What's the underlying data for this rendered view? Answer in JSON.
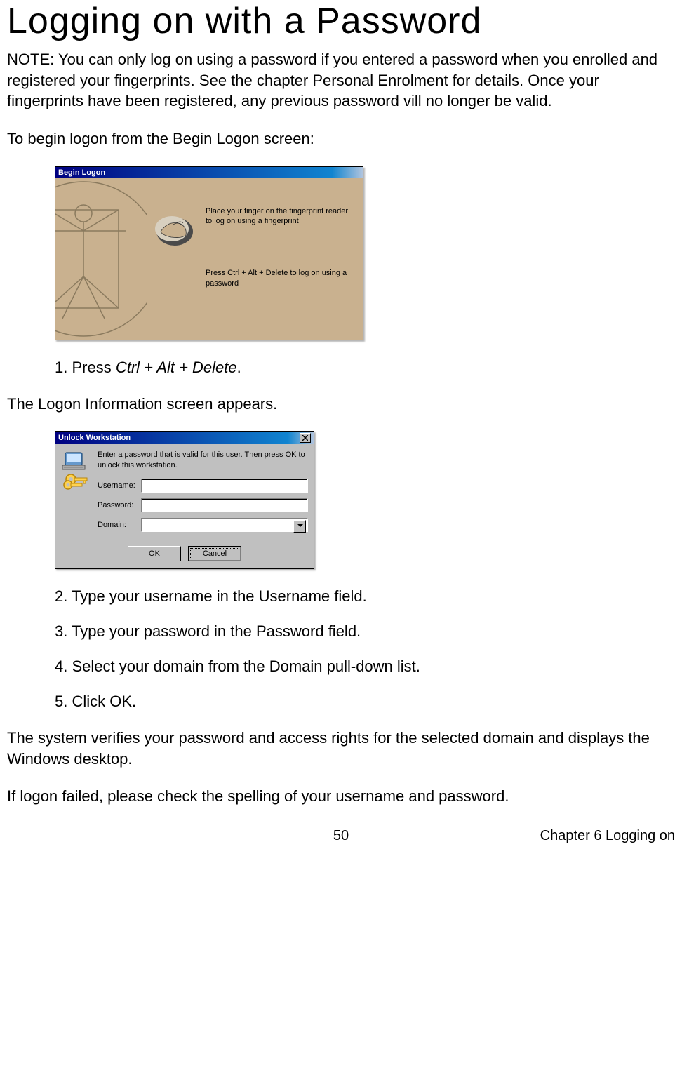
{
  "title": "Logging on with a Password",
  "note_label": "NOTE:",
  "note_text": " You can only log on using a password if you entered a password when you enrolled and registered your fingerprints. See the chapter Personal Enrolment for details. Once your fingerprints have been registered, any previous password vill no longer be valid.",
  "intro": "To begin logon from the Begin Logon screen:",
  "begin_dialog": {
    "title": "Begin Logon",
    "text1": "Place your finger on the fingerprint reader to log on using a fingerprint",
    "text2": "Press Ctrl + Alt + Delete to log on using a password"
  },
  "step1_prefix": "1. Press ",
  "step1_italic": "Ctrl + Alt + Delete",
  "step1_suffix": ".",
  "logon_info_text": "The Logon Information screen appears.",
  "unlock_dialog": {
    "title": "Unlock Workstation",
    "instruction": "Enter a password that is valid for this user. Then press OK to unlock this workstation.",
    "username_label": "Username:",
    "password_label": "Password:",
    "domain_label": "Domain:",
    "ok_button": "OK",
    "cancel_button": "Cancel"
  },
  "step2_prefix": "2. Type your username in the ",
  "step2_bold": "Username",
  "step2_suffix": " field.",
  "step3_prefix": "3. Type your password in the ",
  "step3_bold": "Password",
  "step3_suffix": " field.",
  "step4_prefix": "4. Select your domain from the ",
  "step4_bold": "Domain",
  "step4_suffix": " pull-down list.",
  "step5_prefix": "5. Click ",
  "step5_bold": "OK",
  "step5_suffix": ".",
  "verify_text": "The system verifies your password and access rights for the selected domain and displays the Windows desktop.",
  "fail_text": "If logon failed, please check the spelling of your username and password.",
  "footer_page": "50",
  "footer_chapter": "Chapter 6 Logging on"
}
